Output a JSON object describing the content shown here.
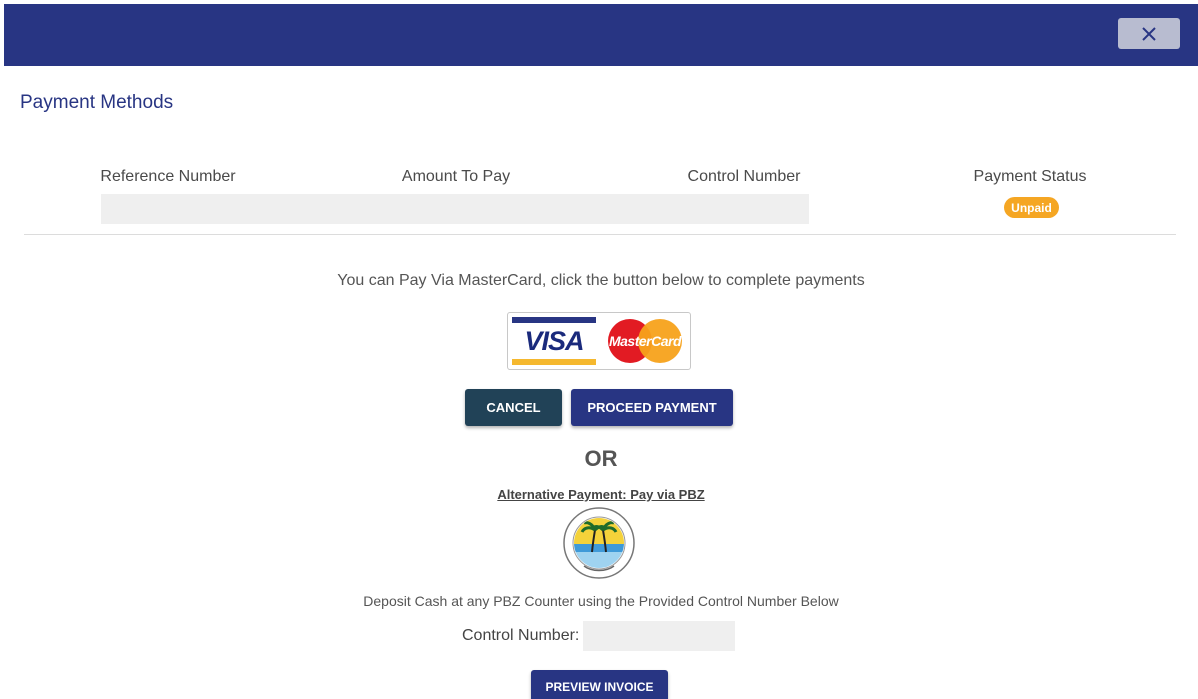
{
  "header": {
    "close_glyph": "×"
  },
  "title": "Payment Methods",
  "summary": {
    "columns": [
      "Reference Number",
      "Amount To Pay",
      "Control Number",
      "Payment Status"
    ],
    "status_value": "Unpaid"
  },
  "instructions": "You can Pay Via MasterCard, click the button below to complete payments",
  "cards": {
    "visa": "VISA",
    "mastercard": "MasterCard"
  },
  "buttons": {
    "cancel": "CANCEL",
    "proceed": "PROCEED PAYMENT",
    "preview": "PREVIEW INVOICE"
  },
  "or_label": "OR",
  "alternative": {
    "link": "Alternative Payment: Pay via PBZ",
    "deposit_text": "Deposit Cash at any PBZ Counter using the Provided Control Number Below",
    "control_label": "Control Number:",
    "control_value": ""
  },
  "colors": {
    "brand": "#283583",
    "cancel": "#214257",
    "status_unpaid": "#f5a623"
  }
}
